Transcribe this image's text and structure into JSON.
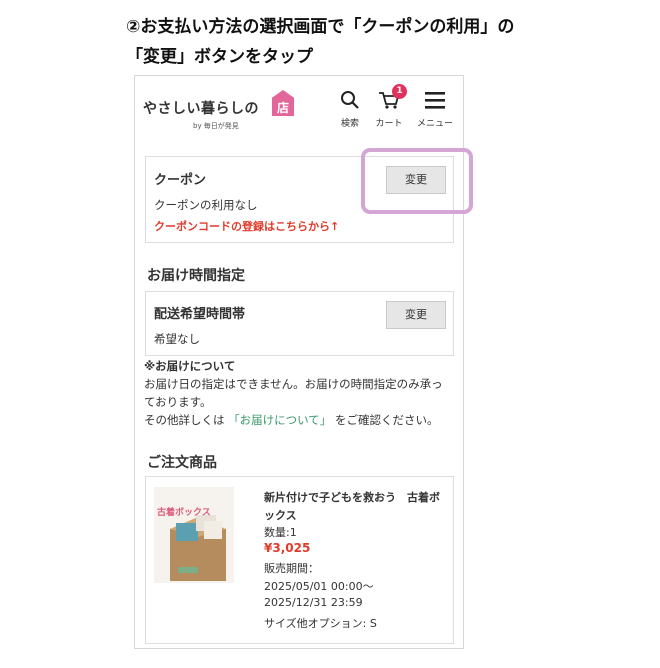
{
  "instruction": {
    "line1": "②お支払い方法の選択画面で「クーポンの利用」の",
    "line2": "「変更」ボタンをタップ"
  },
  "header": {
    "logo_text": "やさしい暮らしの",
    "logo_mark": "店",
    "logo_sub": "by 毎日が発見",
    "search_label": "検索",
    "cart_label": "カート",
    "cart_count": "1",
    "menu_label": "メニュー"
  },
  "coupon": {
    "title": "クーポン",
    "change_label": "変更",
    "status": "クーポンの利用なし",
    "register_link": "クーポンコードの登録はこちらから↑"
  },
  "delivery_time": {
    "section_title": "お届け時間指定",
    "panel_title": "配送希望時間帯",
    "change_label": "変更",
    "value": "希望なし"
  },
  "notice": {
    "heading": "※お届けについて",
    "line1": "お届け日の指定はできません。お届けの時間指定のみ承っ",
    "line2": "ております。",
    "line3_pre": "その他詳しくは",
    "line3_link": "「お届けについて」",
    "line3_post": "をご確認ください。"
  },
  "order": {
    "section_title": "ご注文商品",
    "product_name_1": "新片付けで子どもを救おう　古着ボ",
    "product_name_2": "ックス",
    "quantity": "数量:1",
    "price": "¥3,025",
    "period_label": "販売期間：",
    "period_start": "2025/05/01 00:00〜",
    "period_end": "2025/12/31 23:59",
    "option": "サイズ他オプション: S",
    "image_label": "古着ボックス"
  },
  "colors": {
    "highlight": "#d4a6d6",
    "badge": "#e0335c",
    "price": "#e03a2a",
    "link_green": "#3a9a6a"
  }
}
